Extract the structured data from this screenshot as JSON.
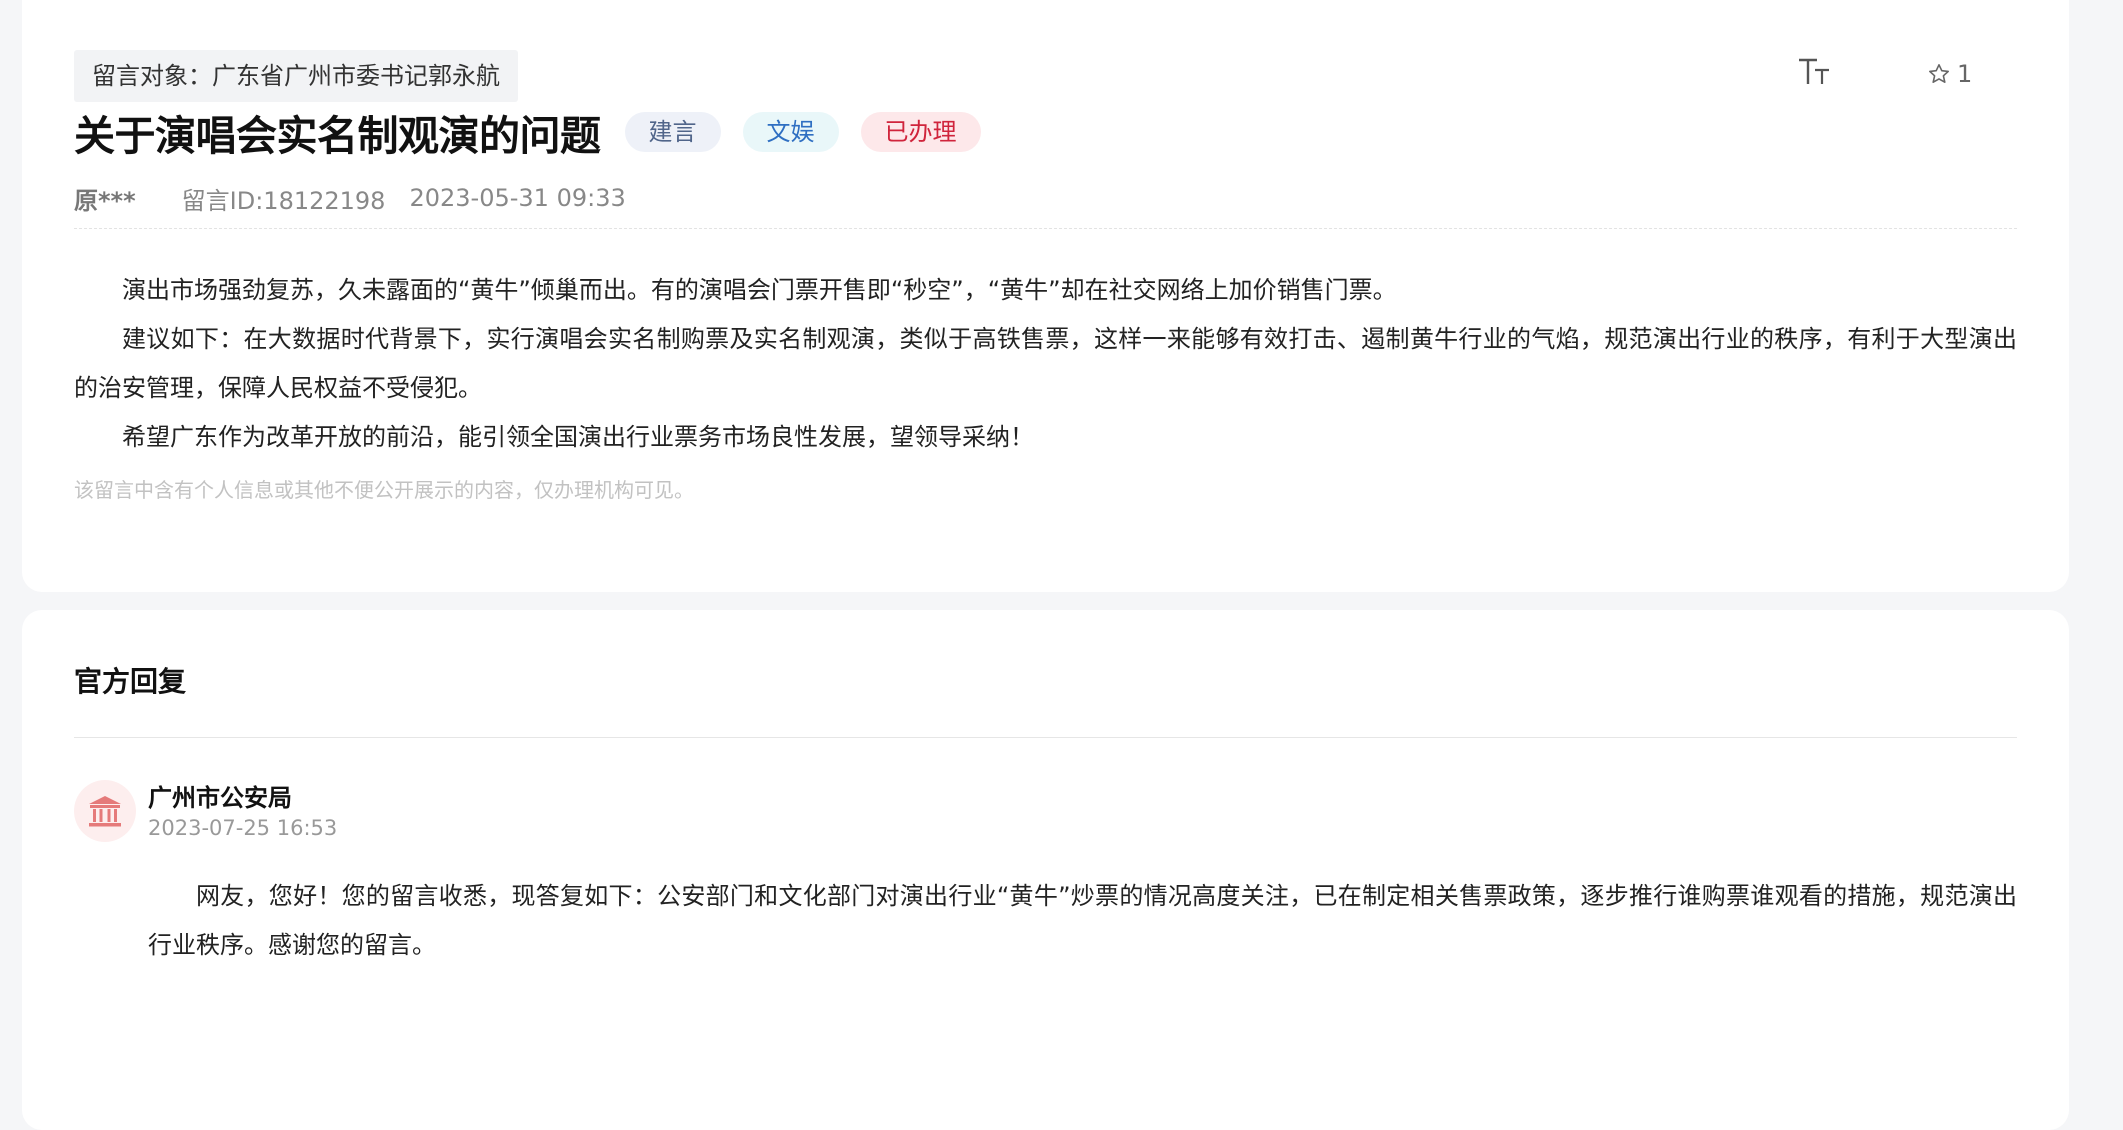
{
  "message": {
    "target_label": "留言对象：广东省广州市委书记郭永航",
    "title": "关于演唱会实名制观演的问题",
    "tags": {
      "type": "建言",
      "category": "文娱",
      "status": "已办理"
    },
    "author": "原***",
    "message_id": "留言ID:18122198",
    "datetime": "2023-05-31 09:33",
    "paragraphs": [
      "演出市场强劲复苏，久未露面的“黄牛”倾巢而出。有的演唱会门票开售即“秒空”，“黄牛”却在社交网络上加价销售门票。",
      "建议如下：在大数据时代背景下，实行演唱会实名制购票及实名制观演，类似于高铁售票，这样一来能够有效打击、遏制黄牛行业的气焰，规范演出行业的秩序，有利于大型演出的治安管理，保障人民权益不受侵犯。",
      " 希望广东作为改革开放的前沿，能引领全国演出行业票务市场良性发展，望领导采纳！"
    ],
    "privacy_note": "该留言中含有个人信息或其他不便公开展示的内容，仅办理机构可见。",
    "favorite_count": "1"
  },
  "icons": {
    "font_size": "font-size-icon",
    "favorite": "star-icon",
    "org_avatar": "government-building-icon"
  },
  "reply": {
    "heading": "官方回复",
    "org_name": "广州市公安局",
    "datetime": "2023-07-25 16:53",
    "text": "网友，您好！您的留言收悉，现答复如下：公安部门和文化部门对演出行业“黄牛”炒票的情况高度关注，已在制定相关售票政策，逐步推行谁购票谁观看的措施，规范演出行业秩序。感谢您的留言。"
  },
  "colors": {
    "tag_status": "#d0243c",
    "tag_category": "#2f6fc2",
    "tag_type": "#50658a",
    "avatar_icon": "#e57a7a"
  }
}
